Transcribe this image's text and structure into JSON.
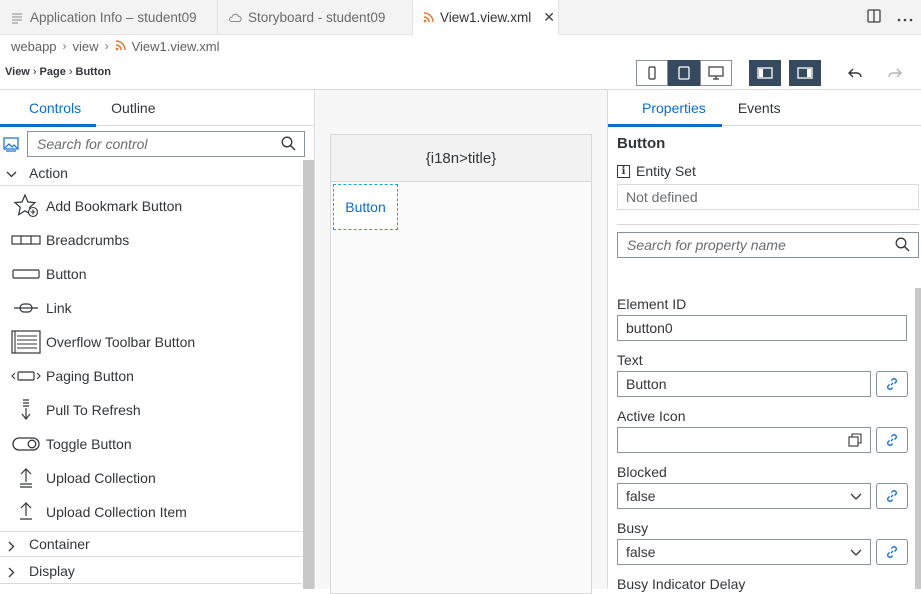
{
  "tabs": [
    {
      "label": "Application Info – student09",
      "icon": "list-icon"
    },
    {
      "label": "Storyboard - student09",
      "icon": "cloud-icon"
    },
    {
      "label": "View1.view.xml",
      "icon": "rss-icon",
      "close": "✕"
    }
  ],
  "path": {
    "items": [
      "webapp",
      "view",
      "View1.view.xml"
    ]
  },
  "view_crumbs": {
    "items": [
      "View",
      "Page",
      "Button"
    ]
  },
  "left": {
    "tabs": [
      "Controls",
      "Outline"
    ],
    "search_placeholder": "Search for control",
    "groups": {
      "action": "Action",
      "container": "Container",
      "display": "Display"
    },
    "controls": [
      {
        "label": "Add Bookmark Button",
        "icon": "star-add-icon"
      },
      {
        "label": "Breadcrumbs",
        "icon": "breadcrumbs-icon"
      },
      {
        "label": "Button",
        "icon": "button-icon"
      },
      {
        "label": "Link",
        "icon": "link-icon"
      },
      {
        "label": "Overflow Toolbar Button",
        "icon": "overflow-toolbar-icon"
      },
      {
        "label": "Paging Button",
        "icon": "paging-button-icon"
      },
      {
        "label": "Pull To Refresh",
        "icon": "pull-refresh-icon"
      },
      {
        "label": "Toggle Button",
        "icon": "toggle-icon"
      },
      {
        "label": "Upload Collection",
        "icon": "upload-icon"
      },
      {
        "label": "Upload Collection Item",
        "icon": "upload-icon"
      }
    ]
  },
  "canvas": {
    "title": "{i18n>title}",
    "button": "Button"
  },
  "right": {
    "tabs": [
      "Properties",
      "Events"
    ],
    "title": "Button",
    "entity_set_label": "Entity Set",
    "entity_set_value": "Not defined",
    "search_placeholder": "Search for property name",
    "props": {
      "element_id": {
        "label": "Element ID",
        "value": "button0"
      },
      "text": {
        "label": "Text",
        "value": "Button"
      },
      "active_icon": {
        "label": "Active Icon",
        "value": ""
      },
      "blocked": {
        "label": "Blocked",
        "value": "false"
      },
      "busy": {
        "label": "Busy",
        "value": "false"
      },
      "busy_delay": {
        "label": "Busy Indicator Delay"
      }
    }
  },
  "colors": {
    "accent": "#0a6ed1",
    "toolbar_selected": "#354a5f",
    "selection_dash": "#1ba6d7"
  }
}
